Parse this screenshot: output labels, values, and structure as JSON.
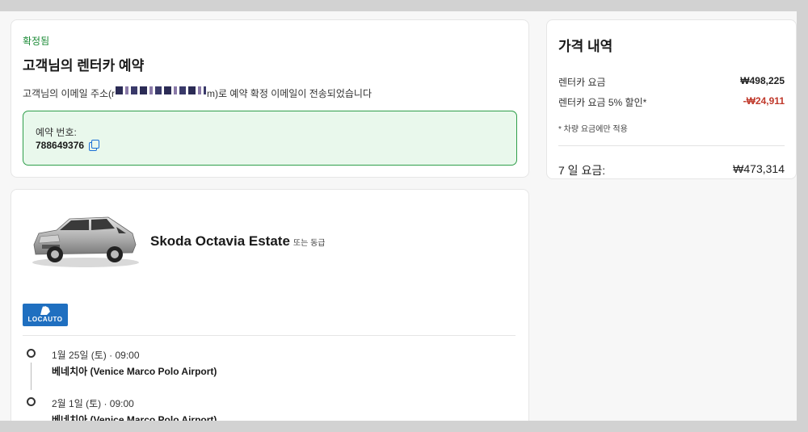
{
  "confirmation": {
    "status": "확정됨",
    "title": "고객님의 렌터카 예약",
    "email_prefix": "고객님의 이메일 주소(r",
    "email_suffix": "m)로 예약 확정 이메일이 전송되었습니다",
    "booking_label": "예약 번호:",
    "booking_number": "788649376"
  },
  "price": {
    "title": "가격 내역",
    "rows": [
      {
        "label": "렌터카 요금",
        "amount": "₩498,225"
      },
      {
        "label": "렌터카 요금 5% 할인*",
        "amount": "-₩24,911"
      }
    ],
    "footnote": "* 차량 요금에만 적용",
    "total_label": "7 일 요금:",
    "total_amount": "₩473,314"
  },
  "car": {
    "name": "Skoda Octavia Estate",
    "class_note": "또는 동급",
    "supplier": "LOCAUTO",
    "pickup": {
      "datetime": "1월 25일 (토) · 09:00",
      "location": "베네치아 (Venice Marco Polo Airport)"
    },
    "dropoff": {
      "datetime": "2월 1일 (토) · 09:00",
      "location": "베네치아 (Venice Marco Polo Airport)"
    }
  },
  "colors": {
    "confirmed_green": "#1a8a35",
    "booking_box_bg": "#e9f8ec",
    "supplier_blue": "#1f6fc0",
    "copy_icon": "#1a6fd6"
  },
  "icons": {
    "copy": "copy-icon",
    "timeline": "timeline-dot-icon"
  }
}
